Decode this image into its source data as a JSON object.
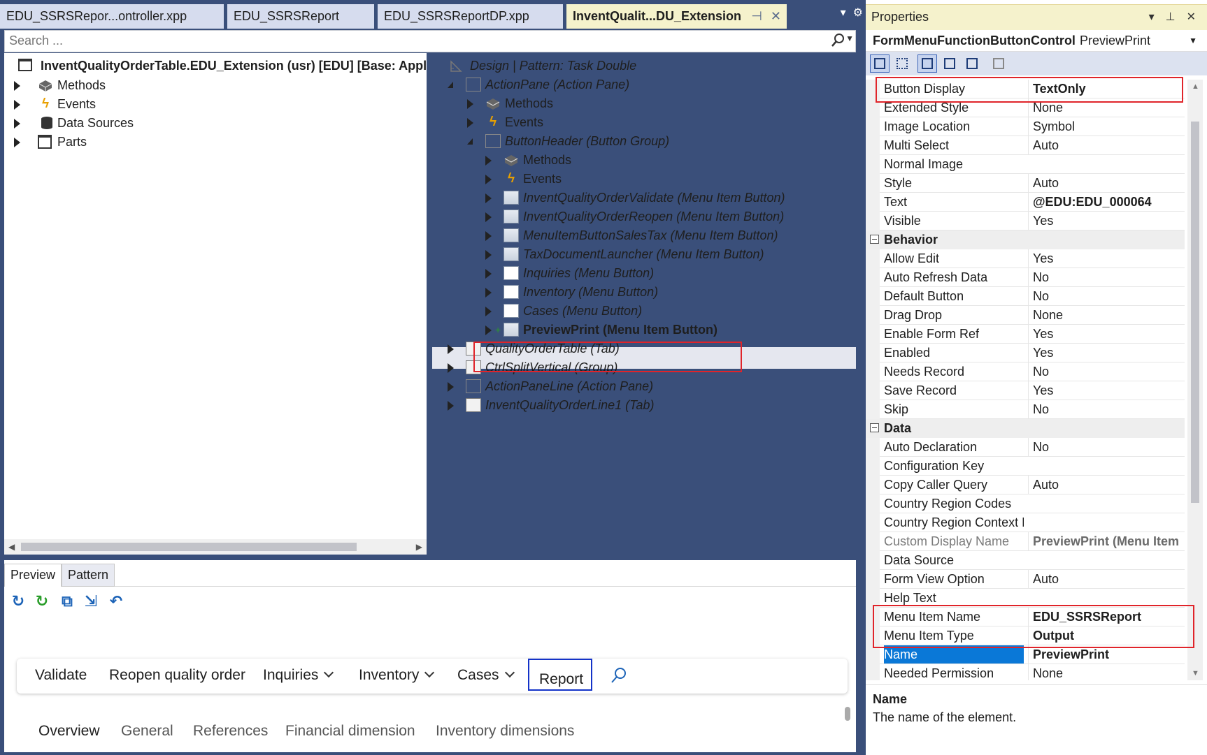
{
  "tabs": [
    {
      "label": "EDU_SSRSRepor...ontroller.xpp"
    },
    {
      "label": "EDU_SSRSReport"
    },
    {
      "label": "EDU_SSRSReportDP.xpp"
    },
    {
      "label": "InventQualit...DU_Extension"
    }
  ],
  "search": {
    "placeholder": "Search ..."
  },
  "left_tree": {
    "root": "InventQualityOrderTable.EDU_Extension (usr) [EDU] [Base: Applic",
    "items": [
      "Methods",
      "Events",
      "Data Sources",
      "Parts"
    ]
  },
  "design_tree": {
    "root": "Design | Pattern: Task Double",
    "nodes": [
      "ActionPane (Action Pane)",
      "Methods",
      "Events",
      "ButtonHeader (Button Group)",
      "Methods",
      "Events",
      "InventQualityOrderValidate (Menu Item Button)",
      "InventQualityOrderReopen (Menu Item Button)",
      "MenuItemButtonSalesTax (Menu Item Button)",
      "TaxDocumentLauncher (Menu Item Button)",
      "Inquiries (Menu Button)",
      "Inventory (Menu Button)",
      "Cases (Menu Button)",
      "PreviewPrint (Menu Item Button)",
      "QualityOrderTable (Tab)",
      "CtrlSplitVertical (Group)",
      "ActionPaneLine (Action Pane)",
      "InventQualityOrderLine1 (Tab)"
    ]
  },
  "preview": {
    "tabs": [
      "Preview",
      "Pattern"
    ],
    "actions": [
      "Validate",
      "Reopen quality order",
      "Inquiries",
      "Inventory",
      "Cases",
      "Report"
    ],
    "fasttabs": [
      "Overview",
      "General",
      "References",
      "Financial dimension",
      "Inventory dimensions"
    ]
  },
  "properties": {
    "title": "Properties",
    "object_type": "FormMenuFunctionButtonControl",
    "object_name": "PreviewPrint",
    "rows_top": [
      {
        "k": "Button Display",
        "v": "TextOnly"
      },
      {
        "k": "Extended Style",
        "v": "None"
      },
      {
        "k": "Image Location",
        "v": "Symbol"
      },
      {
        "k": "Multi Select",
        "v": "Auto"
      },
      {
        "k": "Normal Image",
        "v": ""
      },
      {
        "k": "Style",
        "v": "Auto"
      },
      {
        "k": "Text",
        "v": "@EDU:EDU_000064"
      },
      {
        "k": "Visible",
        "v": "Yes"
      }
    ],
    "cat_behavior": "Behavior",
    "rows_behavior": [
      {
        "k": "Allow Edit",
        "v": "Yes"
      },
      {
        "k": "Auto Refresh Data",
        "v": "No"
      },
      {
        "k": "Default Button",
        "v": "No"
      },
      {
        "k": "Drag Drop",
        "v": "None"
      },
      {
        "k": "Enable Form Ref",
        "v": "Yes"
      },
      {
        "k": "Enabled",
        "v": "Yes"
      },
      {
        "k": "Needs Record",
        "v": "No"
      },
      {
        "k": "Save Record",
        "v": "Yes"
      },
      {
        "k": "Skip",
        "v": "No"
      }
    ],
    "cat_data": "Data",
    "rows_data": [
      {
        "k": "Auto Declaration",
        "v": "No"
      },
      {
        "k": "Configuration Key",
        "v": ""
      },
      {
        "k": "Copy Caller Query",
        "v": "Auto"
      },
      {
        "k": "Country Region Codes",
        "v": ""
      },
      {
        "k": "Country Region Context F",
        "v": ""
      },
      {
        "k": "Custom Display Name",
        "v": "PreviewPrint (Menu Item"
      },
      {
        "k": "Data Source",
        "v": ""
      },
      {
        "k": "Form View Option",
        "v": "Auto"
      },
      {
        "k": "Help Text",
        "v": ""
      },
      {
        "k": "Menu Item Name",
        "v": "EDU_SSRSReport"
      },
      {
        "k": "Menu Item Type",
        "v": "Output"
      },
      {
        "k": "Name",
        "v": "PreviewPrint"
      },
      {
        "k": "Needed Permission",
        "v": "None"
      }
    ],
    "desc_title": "Name",
    "desc_text": "The name of the element."
  }
}
